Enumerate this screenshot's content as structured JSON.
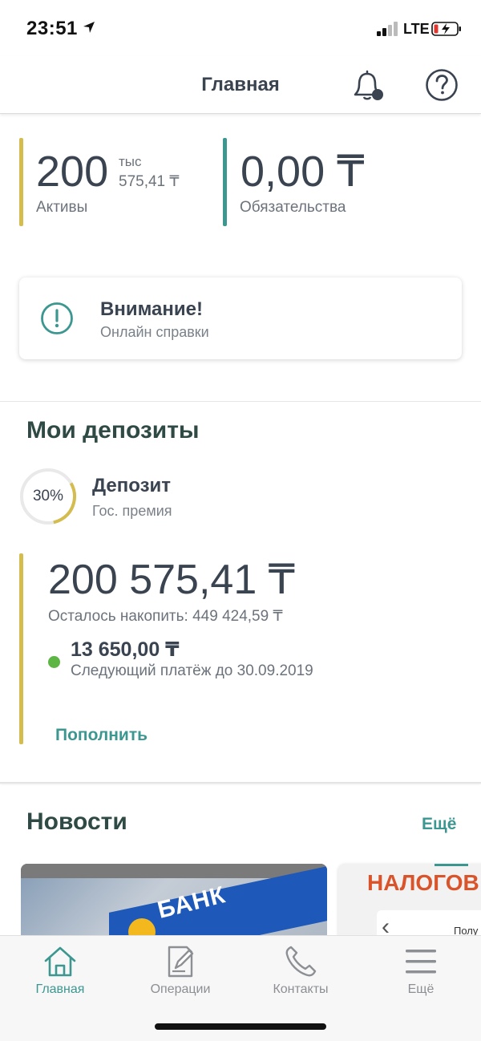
{
  "status_bar": {
    "time": "23:51",
    "network": "LTE"
  },
  "header": {
    "title": "Главная",
    "icons": [
      "bell-icon",
      "help-icon"
    ]
  },
  "summary": {
    "assets": {
      "big": "200",
      "unit": "тыс",
      "small": "575,41 ₸",
      "label": "Активы",
      "color": "#d4bd4e"
    },
    "liabilities": {
      "big": "0,00 ₸",
      "label": "Обязательства",
      "color": "#3c9790"
    }
  },
  "alert": {
    "title": "Внимание!",
    "subtitle": "Онлайн справки",
    "icon": "exclamation-circle-icon"
  },
  "deposits": {
    "title": "Мои депозиты",
    "item": {
      "progress_text": "30%",
      "progress": 0.3,
      "name": "Депозит",
      "type": "Гос. премия",
      "amount": "200 575,41 ₸",
      "remaining": "Осталось накопить: 449 424,59 ₸",
      "payment_amount": "13 650,00 ₸",
      "payment_due": "Следующий платёж до 30.09.2019",
      "action": "Пополнить"
    }
  },
  "news": {
    "title": "Новости",
    "more": "Ещё",
    "cards": [
      {
        "text": "БАНК"
      },
      {
        "text": "НАЛОГОВ",
        "detail": "Полу"
      }
    ]
  },
  "tabbar": {
    "items": [
      {
        "label": "Главная",
        "icon": "home-icon",
        "active": true
      },
      {
        "label": "Операции",
        "icon": "edit-document-icon",
        "active": false
      },
      {
        "label": "Контакты",
        "icon": "phone-icon",
        "active": false
      },
      {
        "label": "Ещё",
        "icon": "menu-icon",
        "active": false
      }
    ]
  },
  "colors": {
    "accent": "#3c9790",
    "gold": "#d4bd4e",
    "text": "#3a4350",
    "success": "#5db544"
  }
}
